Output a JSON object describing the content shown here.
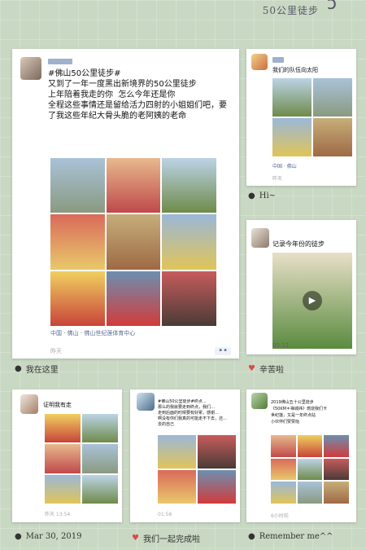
{
  "title": "50公里徒步",
  "posts": [
    {
      "text": "#佛山50公里徒步#\n又到了一年一度黑出新境界的50公里徒步\n上年陪着我走的你  怎么今年还是你\n全程这些事情还是留给活力四射的小姐姐们吧，要了我这些年纪大骨头脆的老阿姨的老命",
      "location": "中国 · 佛山 · 佛山世纪莲体育中心",
      "time": "昨天",
      "more": "••",
      "caption": "我在这里"
    },
    {
      "text": "我们的队伍向太阳",
      "location": "中国 · 佛山",
      "time": "昨天",
      "caption": "Hi~"
    },
    {
      "text": "记录今年份的徒步",
      "time": "00:12",
      "caption": "辛苦啦"
    },
    {
      "text": "证明我有走",
      "time": "昨天  13:54",
      "caption": "Mar 30, 2019"
    },
    {
      "text": "#佛山50公里徒步#终点…\n那么的我就要走到终点，我们…\n走到后面的时候要有好累，感谢…\n啊没有你们我真的可能走不下去，还…\n去的自己",
      "time": "01:56",
      "caption": "我们一起完成啦"
    },
    {
      "text": "2019佛山五十公里徒步\n《50KM＊禅城纬》燃烧我们卡\n世纪莲，又是一年终点站\n小伙伴们赞赞哒",
      "time": "6小时前",
      "caption": "Remember me^^"
    }
  ]
}
